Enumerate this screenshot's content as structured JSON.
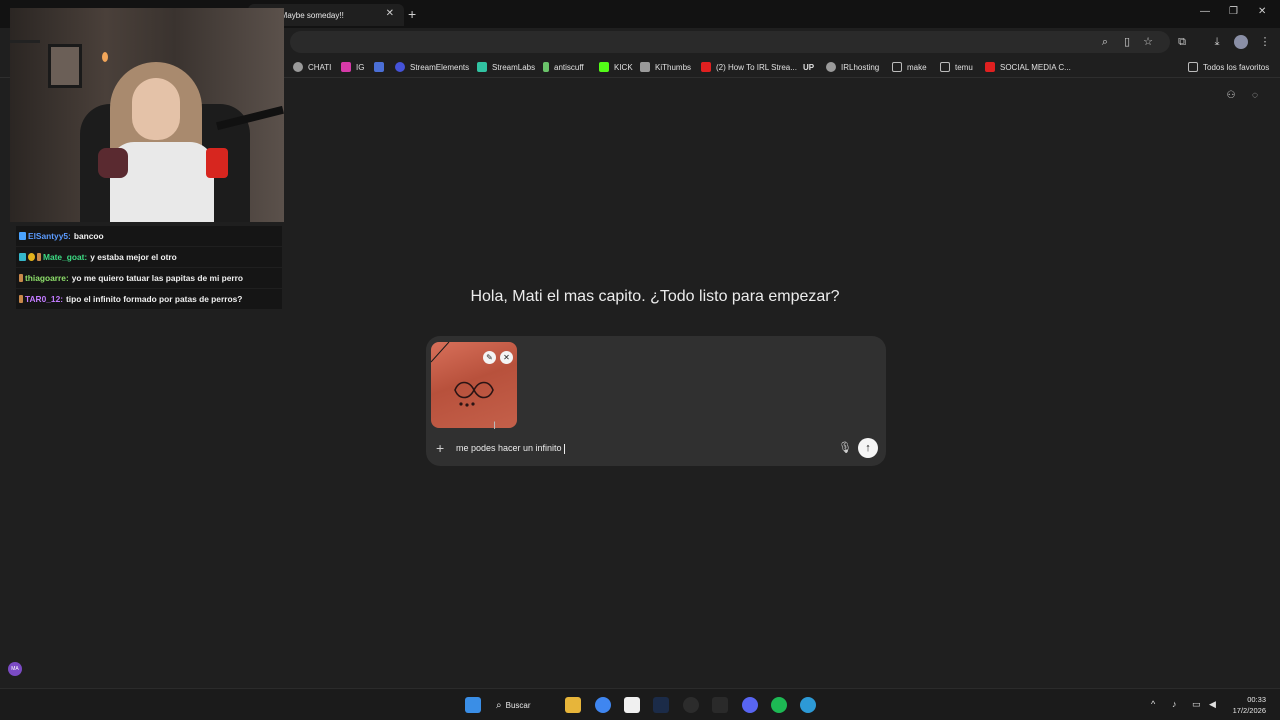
{
  "browser": {
    "active_tab_title": "n Maybe someday!!",
    "new_tab_symbol": "+"
  },
  "bookmarks": [
    {
      "label": "CHATI",
      "color": "#9a9a9a"
    },
    {
      "label": "IG",
      "color": "#d63aa8"
    },
    {
      "label": "",
      "color": "#4b6fd6"
    },
    {
      "label": "StreamElements",
      "color": "#4553d9"
    },
    {
      "label": "StreamLabs",
      "color": "#31c3a2"
    },
    {
      "label": "antiscuff",
      "color": "#6ac36a"
    },
    {
      "label": "KICK",
      "color": "#53fc18"
    },
    {
      "label": "KiThumbs",
      "color": "#9a9a9a"
    },
    {
      "label": "(2) How To IRL Strea...",
      "color": "#e02020"
    },
    {
      "label": "UP",
      "color": "#000000"
    },
    {
      "label": "IRLhosting",
      "color": "#9a9a9a"
    },
    {
      "label": "make",
      "color": "#9a9a9a"
    },
    {
      "label": "temu",
      "color": "#9a9a9a"
    },
    {
      "label": "SOCIAL MEDIA C...",
      "color": "#e02020"
    }
  ],
  "bookmarks_all": "Todos los favoritos",
  "chat": [
    {
      "user": "ElSantyy5:",
      "user_color": "#5b9bff",
      "message": "bancoo"
    },
    {
      "user": "Mate_goat:",
      "user_color": "#3ddc84",
      "message": "y estaba mejor el otro"
    },
    {
      "user": "thiagoarre:",
      "user_color": "#8ee06b",
      "message": "yo me quiero tatuar las papitas de mi perro"
    },
    {
      "user": "TAR0_12:",
      "user_color": "#c27bff",
      "message": "tipo el infinito formado por patas de perros?"
    }
  ],
  "main": {
    "greeting": "Hola, Mati el mas capito. ¿Todo listo para empezar?",
    "input_value": "me podes hacer un infinito",
    "avatar_initials": "MA"
  },
  "taskbar": {
    "search_label": "Buscar",
    "time": "00:33",
    "date": "17/2/2026"
  }
}
